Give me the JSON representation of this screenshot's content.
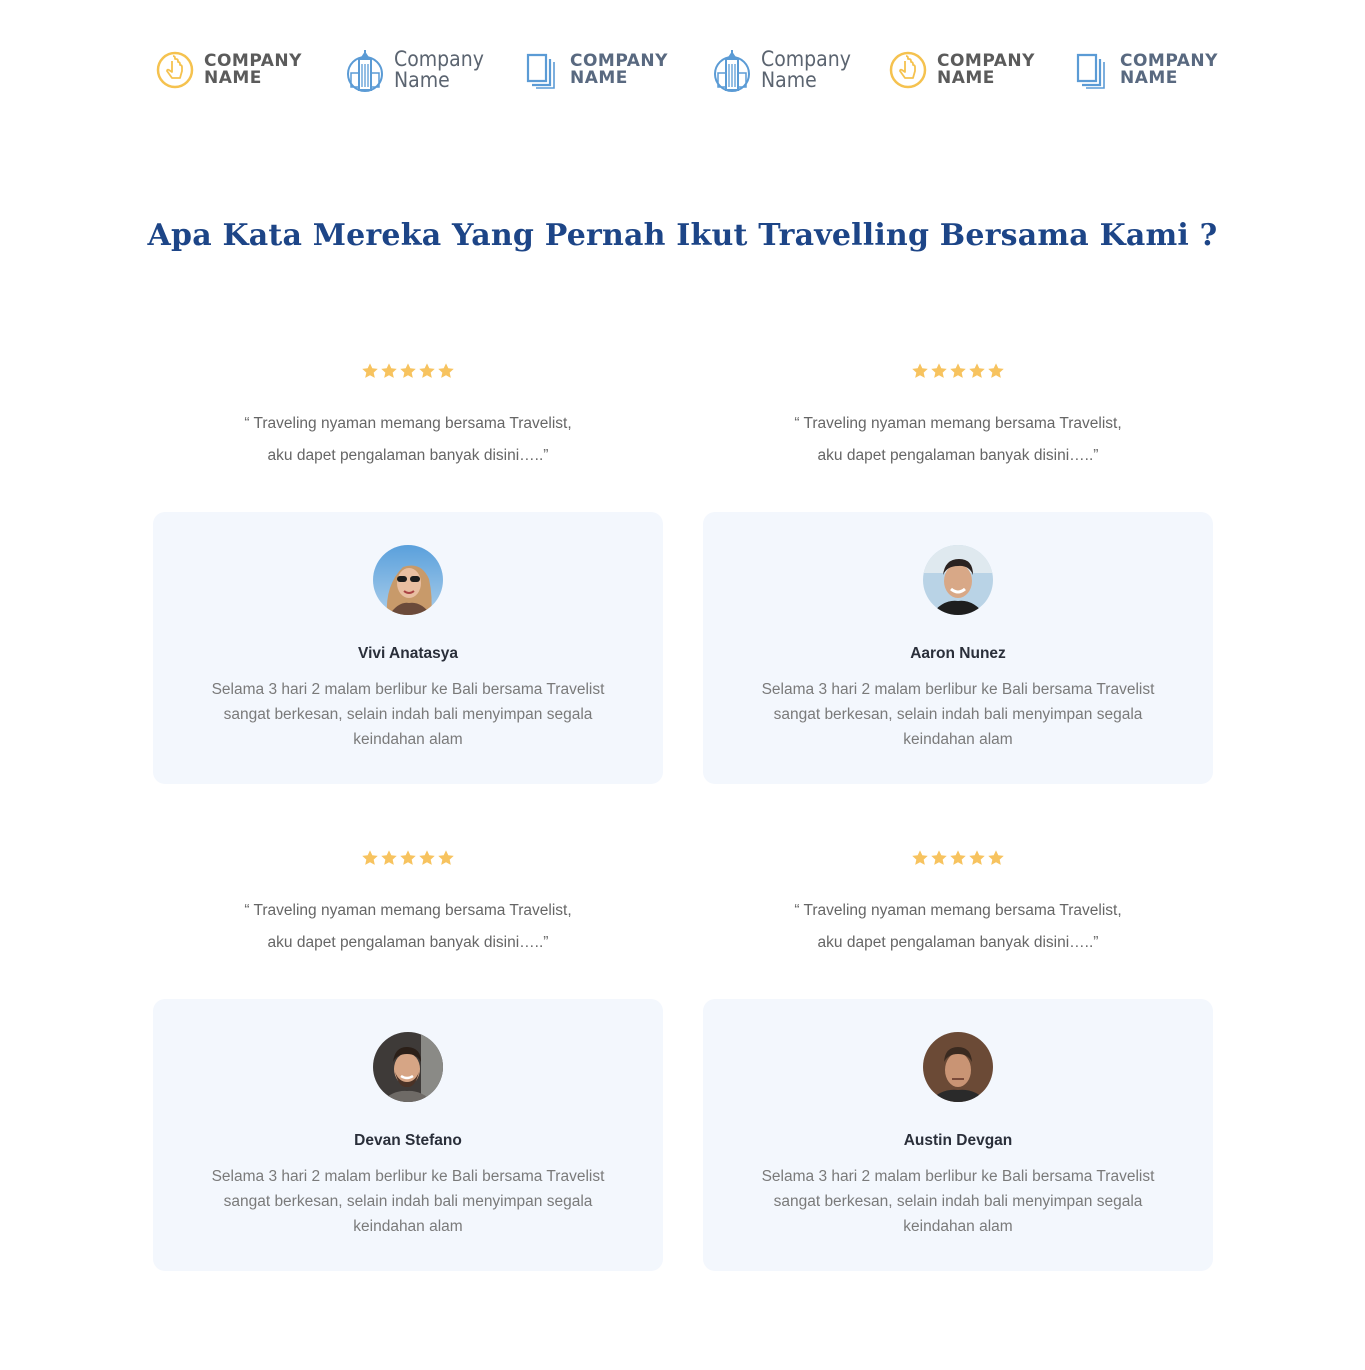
{
  "logos": [
    {
      "icon": "pointer-circle-icon",
      "line1": "COMPANY",
      "line2": "NAME",
      "style": "bold",
      "color": "#f5c24f"
    },
    {
      "icon": "building-globe-icon",
      "line1": "Company",
      "line2": "Name",
      "style": "light",
      "color": "#5b9bd5"
    },
    {
      "icon": "stacked-pages-icon",
      "line1": "COMPANY",
      "line2": "NAME",
      "style": "bold-blue",
      "color": "#5b9bd5"
    },
    {
      "icon": "building-globe-icon",
      "line1": "Company",
      "line2": "Name",
      "style": "light",
      "color": "#5b9bd5"
    },
    {
      "icon": "pointer-circle-icon",
      "line1": "COMPANY",
      "line2": "NAME",
      "style": "bold",
      "color": "#f5c24f"
    },
    {
      "icon": "stacked-pages-icon",
      "line1": "COMPANY",
      "line2": "NAME",
      "style": "bold-blue",
      "color": "#5b9bd5"
    }
  ],
  "section": {
    "title": "Apa Kata Mereka Yang Pernah Ikut Travelling Bersama Kami ?"
  },
  "colors": {
    "title": "#1d4587",
    "star": "#f7c35f",
    "card_bg": "#f3f7fd"
  },
  "testimonials": [
    {
      "rating": 5,
      "quote_line1": "“ Traveling nyaman memang bersama Travelist,",
      "quote_line2": "aku dapet pengalaman banyak disini…..”",
      "name": "Vivi Anatasya",
      "review": "Selama 3 hari 2 malam berlibur ke Bali bersama Travelist sangat berkesan, selain indah bali menyimpan segala keindahan alam",
      "avatar": "woman-sunglasses-avatar"
    },
    {
      "rating": 5,
      "quote_line1": "“ Traveling nyaman memang bersama Travelist,",
      "quote_line2": "aku dapet pengalaman banyak disini…..”",
      "name": "Aaron Nunez",
      "review": "Selama 3 hari 2 malam berlibur ke Bali bersama Travelist sangat berkesan, selain indah bali menyimpan segala keindahan alam",
      "avatar": "man-smiling-avatar"
    },
    {
      "rating": 5,
      "quote_line1": "“ Traveling nyaman memang bersama Travelist,",
      "quote_line2": "aku dapet pengalaman banyak disini…..”",
      "name": "Devan Stefano",
      "review": "Selama 3 hari 2 malam berlibur ke Bali bersama Travelist sangat berkesan, selain indah bali menyimpan segala keindahan alam",
      "avatar": "man-beard-avatar"
    },
    {
      "rating": 5,
      "quote_line1": "“ Traveling nyaman memang bersama Travelist,",
      "quote_line2": "aku dapet pengalaman banyak disini…..”",
      "name": "Austin Devgan",
      "review": "Selama 3 hari 2 malam berlibur ke Bali bersama Travelist sangat berkesan, selain indah bali menyimpan segala keindahan alam",
      "avatar": "man-serious-avatar"
    }
  ]
}
